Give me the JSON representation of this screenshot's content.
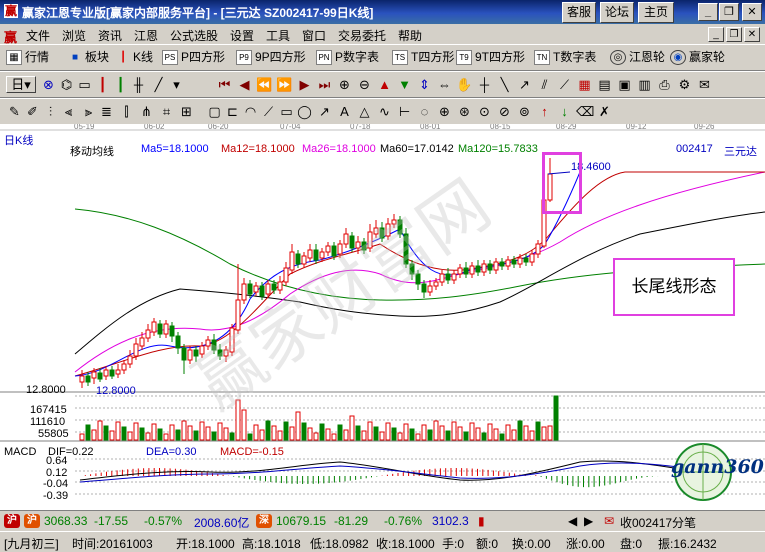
{
  "title": "赢家江恩专业版[赢家内部服务平台] - [三元达   SZ002417-99日K线]",
  "title_buttons": [
    "客服",
    "论坛",
    "主页"
  ],
  "window_buttons": {
    "minimize": "_",
    "restore": "❐",
    "close": "✕"
  },
  "menu": {
    "logo": "赢",
    "items": [
      "文件",
      "浏览",
      "资讯",
      "江恩",
      "公式选股",
      "设置",
      "工具",
      "窗口",
      "交易委托",
      "帮助"
    ]
  },
  "toolbar1": [
    {
      "label": "行情",
      "icon": "grid-icon"
    },
    {
      "label": "板块",
      "icon": "blocks-icon"
    },
    {
      "label": "K线",
      "icon": "candle-icon"
    },
    {
      "label": "P四方形",
      "icon": "p-square-icon",
      "tag": "PS"
    },
    {
      "label": "9P四方形",
      "icon": "9p-square-icon",
      "tag": "P9"
    },
    {
      "label": "P数字表",
      "icon": "p-number-icon",
      "tag": "PN"
    },
    {
      "label": "T四方形",
      "icon": "t-square-icon",
      "tag": "TS"
    },
    {
      "label": "9T四方形",
      "icon": "9t-square-icon",
      "tag": "T9"
    },
    {
      "label": "T数字表",
      "icon": "t-number-icon",
      "tag": "TN"
    },
    {
      "label": "江恩轮",
      "icon": "gann-wheel-icon"
    },
    {
      "label": "赢家轮",
      "icon": "winner-wheel-icon"
    }
  ],
  "toolbar2": {
    "period": "日"
  },
  "chart": {
    "period_label": "日K线",
    "indicator_title": "移动均线",
    "stock_code": "002417",
    "stock_name": "三元达",
    "ma": [
      {
        "label": "Ma5=18.1000",
        "color": "#0000ff"
      },
      {
        "label": "Ma12=18.1000",
        "color": "#c00000"
      },
      {
        "label": "Ma26=18.1000",
        "color": "#e000e0"
      },
      {
        "label": "Ma60=17.0142",
        "color": "#000000"
      },
      {
        "label": "Ma120=15.7833",
        "color": "#008000"
      }
    ],
    "dates": [
      "05-19",
      "06-02",
      "06-20",
      "07-04",
      "07-18",
      "08-01",
      "08-15",
      "08-29",
      "09-12",
      "09-26"
    ],
    "high_label": "18.4600",
    "low_label": "12.8000",
    "axis_low": "12.8000",
    "vol_ticks": [
      "167415",
      "111610",
      "55805"
    ],
    "macd": {
      "title": "MACD",
      "dif": "DIF=0.22",
      "dea": "DEA=0.30",
      "macd": "MACD=-0.15",
      "ticks": [
        "0.64",
        "0.12",
        "-0.04",
        "-0.39"
      ]
    }
  },
  "annotation": "长尾线形态",
  "logo": {
    "text": "gann360"
  },
  "status1": {
    "sh_index": "3068.33",
    "sh_change": "-17.55",
    "sh_pct": "-0.57%",
    "sh_amount": "2008.60亿",
    "sz_index": "10679.15",
    "sz_change": "-81.29",
    "sz_pct": "-0.76%",
    "sz_amount": "3102.3",
    "alert": "收002417分笔"
  },
  "status2": [
    "[九月初三]",
    "时间:20161003",
    "开:18.1000",
    "高:18.1018",
    "低:18.0982",
    "收:18.1000",
    "手:0",
    "额:0",
    "换:0.00",
    "涨:0.00",
    "盘:0",
    "振:16.2432"
  ],
  "colors": {
    "up": "#e00000",
    "down": "#008000",
    "ma5": "#0000ff",
    "ma12": "#c00000",
    "ma26": "#e000e0",
    "ma60": "#000000",
    "ma120": "#008000",
    "annotation_border": "#e040e0"
  }
}
